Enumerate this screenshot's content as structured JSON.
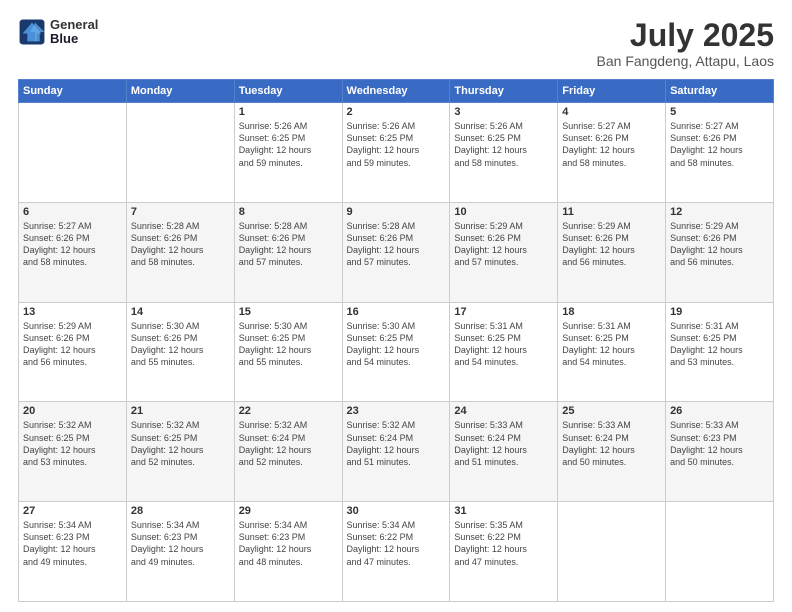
{
  "header": {
    "logo_line1": "General",
    "logo_line2": "Blue",
    "title": "July 2025",
    "subtitle": "Ban Fangdeng, Attapu, Laos"
  },
  "days_of_week": [
    "Sunday",
    "Monday",
    "Tuesday",
    "Wednesday",
    "Thursday",
    "Friday",
    "Saturday"
  ],
  "weeks": [
    [
      {
        "day": "",
        "detail": ""
      },
      {
        "day": "",
        "detail": ""
      },
      {
        "day": "1",
        "detail": "Sunrise: 5:26 AM\nSunset: 6:25 PM\nDaylight: 12 hours\nand 59 minutes."
      },
      {
        "day": "2",
        "detail": "Sunrise: 5:26 AM\nSunset: 6:25 PM\nDaylight: 12 hours\nand 59 minutes."
      },
      {
        "day": "3",
        "detail": "Sunrise: 5:26 AM\nSunset: 6:25 PM\nDaylight: 12 hours\nand 58 minutes."
      },
      {
        "day": "4",
        "detail": "Sunrise: 5:27 AM\nSunset: 6:26 PM\nDaylight: 12 hours\nand 58 minutes."
      },
      {
        "day": "5",
        "detail": "Sunrise: 5:27 AM\nSunset: 6:26 PM\nDaylight: 12 hours\nand 58 minutes."
      }
    ],
    [
      {
        "day": "6",
        "detail": "Sunrise: 5:27 AM\nSunset: 6:26 PM\nDaylight: 12 hours\nand 58 minutes."
      },
      {
        "day": "7",
        "detail": "Sunrise: 5:28 AM\nSunset: 6:26 PM\nDaylight: 12 hours\nand 58 minutes."
      },
      {
        "day": "8",
        "detail": "Sunrise: 5:28 AM\nSunset: 6:26 PM\nDaylight: 12 hours\nand 57 minutes."
      },
      {
        "day": "9",
        "detail": "Sunrise: 5:28 AM\nSunset: 6:26 PM\nDaylight: 12 hours\nand 57 minutes."
      },
      {
        "day": "10",
        "detail": "Sunrise: 5:29 AM\nSunset: 6:26 PM\nDaylight: 12 hours\nand 57 minutes."
      },
      {
        "day": "11",
        "detail": "Sunrise: 5:29 AM\nSunset: 6:26 PM\nDaylight: 12 hours\nand 56 minutes."
      },
      {
        "day": "12",
        "detail": "Sunrise: 5:29 AM\nSunset: 6:26 PM\nDaylight: 12 hours\nand 56 minutes."
      }
    ],
    [
      {
        "day": "13",
        "detail": "Sunrise: 5:29 AM\nSunset: 6:26 PM\nDaylight: 12 hours\nand 56 minutes."
      },
      {
        "day": "14",
        "detail": "Sunrise: 5:30 AM\nSunset: 6:26 PM\nDaylight: 12 hours\nand 55 minutes."
      },
      {
        "day": "15",
        "detail": "Sunrise: 5:30 AM\nSunset: 6:25 PM\nDaylight: 12 hours\nand 55 minutes."
      },
      {
        "day": "16",
        "detail": "Sunrise: 5:30 AM\nSunset: 6:25 PM\nDaylight: 12 hours\nand 54 minutes."
      },
      {
        "day": "17",
        "detail": "Sunrise: 5:31 AM\nSunset: 6:25 PM\nDaylight: 12 hours\nand 54 minutes."
      },
      {
        "day": "18",
        "detail": "Sunrise: 5:31 AM\nSunset: 6:25 PM\nDaylight: 12 hours\nand 54 minutes."
      },
      {
        "day": "19",
        "detail": "Sunrise: 5:31 AM\nSunset: 6:25 PM\nDaylight: 12 hours\nand 53 minutes."
      }
    ],
    [
      {
        "day": "20",
        "detail": "Sunrise: 5:32 AM\nSunset: 6:25 PM\nDaylight: 12 hours\nand 53 minutes."
      },
      {
        "day": "21",
        "detail": "Sunrise: 5:32 AM\nSunset: 6:25 PM\nDaylight: 12 hours\nand 52 minutes."
      },
      {
        "day": "22",
        "detail": "Sunrise: 5:32 AM\nSunset: 6:24 PM\nDaylight: 12 hours\nand 52 minutes."
      },
      {
        "day": "23",
        "detail": "Sunrise: 5:32 AM\nSunset: 6:24 PM\nDaylight: 12 hours\nand 51 minutes."
      },
      {
        "day": "24",
        "detail": "Sunrise: 5:33 AM\nSunset: 6:24 PM\nDaylight: 12 hours\nand 51 minutes."
      },
      {
        "day": "25",
        "detail": "Sunrise: 5:33 AM\nSunset: 6:24 PM\nDaylight: 12 hours\nand 50 minutes."
      },
      {
        "day": "26",
        "detail": "Sunrise: 5:33 AM\nSunset: 6:23 PM\nDaylight: 12 hours\nand 50 minutes."
      }
    ],
    [
      {
        "day": "27",
        "detail": "Sunrise: 5:34 AM\nSunset: 6:23 PM\nDaylight: 12 hours\nand 49 minutes."
      },
      {
        "day": "28",
        "detail": "Sunrise: 5:34 AM\nSunset: 6:23 PM\nDaylight: 12 hours\nand 49 minutes."
      },
      {
        "day": "29",
        "detail": "Sunrise: 5:34 AM\nSunset: 6:23 PM\nDaylight: 12 hours\nand 48 minutes."
      },
      {
        "day": "30",
        "detail": "Sunrise: 5:34 AM\nSunset: 6:22 PM\nDaylight: 12 hours\nand 47 minutes."
      },
      {
        "day": "31",
        "detail": "Sunrise: 5:35 AM\nSunset: 6:22 PM\nDaylight: 12 hours\nand 47 minutes."
      },
      {
        "day": "",
        "detail": ""
      },
      {
        "day": "",
        "detail": ""
      }
    ]
  ]
}
